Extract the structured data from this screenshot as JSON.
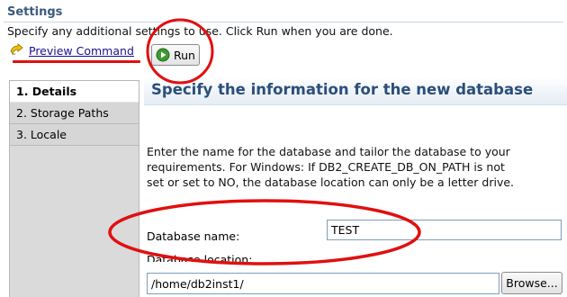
{
  "header": {
    "title": "Settings",
    "instructions": "Specify any additional settings to use. Click Run when you are done."
  },
  "toolbar": {
    "preview_label": "Preview Command",
    "run_label": "Run"
  },
  "nav": {
    "items": [
      {
        "label": "1. Details",
        "active": true
      },
      {
        "label": "2. Storage Paths",
        "active": false
      },
      {
        "label": "3. Locale",
        "active": false
      }
    ]
  },
  "main": {
    "title": "Specify the information for the new database",
    "description": "Enter the name for the database and tailor the database to your requirements. For Windows: If DB2_CREATE_DB_ON_PATH is not set or set to NO, the database location can only be a letter drive.",
    "db_name_label": "Database name:",
    "db_name_value": "TEST",
    "db_location_label": "Database location:",
    "db_location_value": "/home/db2inst1/",
    "browse_label": "Browse..."
  },
  "colors": {
    "annotation": "#e01010",
    "heading": "#2b4f7a",
    "link": "#1a0f8f"
  },
  "icons": {
    "preview": "preview-command-icon",
    "run": "run-icon"
  }
}
